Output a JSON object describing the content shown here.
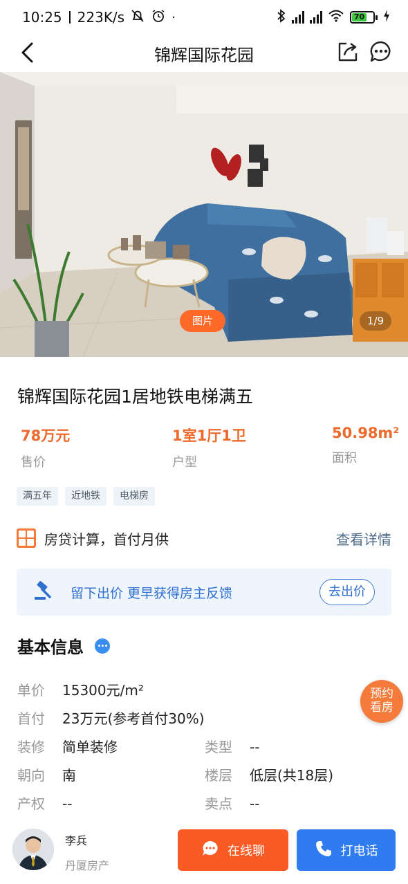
{
  "status_bar": {
    "time": "10:25",
    "speed": "223K/s",
    "battery": "70"
  },
  "nav": {
    "title": "锦辉国际花园",
    "back_icon": "chevron-left-icon",
    "share_icon": "share-icon",
    "more_icon": "more-chat-icon"
  },
  "photo": {
    "badge": "图片",
    "counter": "1/9"
  },
  "listing": {
    "title": "锦辉国际花园1居地铁电梯满五",
    "stats": [
      {
        "value": "78万元",
        "label": "售价"
      },
      {
        "value": "1室1厅1卫",
        "label": "户型"
      },
      {
        "value": "50.98m²",
        "label": "面积"
      }
    ],
    "tags": [
      "满五年",
      "近地铁",
      "电梯房"
    ]
  },
  "loan": {
    "label": "房贷计算，首付月供",
    "link": "查看详情"
  },
  "offer": {
    "text": "留下出价 更早获得房主反馈",
    "button": "去出价"
  },
  "basic_info": {
    "title": "基本信息",
    "rows": {
      "unit_price": {
        "key": "单价",
        "value": "15300元/m²"
      },
      "down_payment": {
        "key": "首付",
        "value": "23万元(参考首付30%)"
      },
      "decoration": {
        "key": "装修",
        "value": "简单装修"
      },
      "type": {
        "key": "类型",
        "value": "--"
      },
      "orientation": {
        "key": "朝向",
        "value": "南"
      },
      "floor": {
        "key": "楼层",
        "value": "低层(共18层)"
      },
      "property_right": {
        "key": "产权",
        "value": "--"
      },
      "selling_point": {
        "key": "卖点",
        "value": "--"
      }
    }
  },
  "book_button": {
    "line1": "预约",
    "line2": "看房"
  },
  "bottom": {
    "agent_name": "李兵",
    "agent_company": "丹厦房产",
    "chat_label": "在线聊",
    "call_label": "打电话"
  },
  "colors": {
    "accent_orange": "#fa5a24",
    "price_orange": "#ee6a2c",
    "primary_blue": "#2f7cf0"
  }
}
